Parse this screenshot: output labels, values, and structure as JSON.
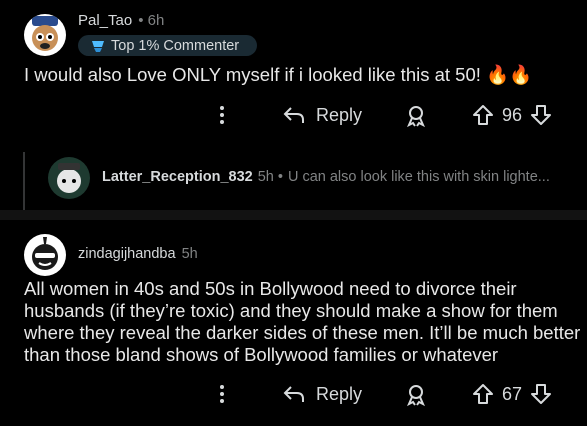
{
  "comments": [
    {
      "username": "Pal_Tao",
      "time": "• 6h",
      "badge": "Top 1% Commenter",
      "body": "I would also Love ONLY myself if i looked like this at 50! 🔥🔥",
      "reply_label": "Reply",
      "votes": "96",
      "reply": {
        "username": "Latter_Reception_832",
        "time": "5h •",
        "preview": "U can also look like this with skin lighte..."
      }
    },
    {
      "username": "zindagijhandba",
      "time": "5h",
      "body_lines": [
        "All women in 40s and 50s in Bollywood need to divorce their",
        "husbands (if they’re toxic) and they should make a show for them",
        "where they reveal the darker sides of these men. It’ll be much better",
        "than those bland shows of Bollywood families or whatever"
      ],
      "reply_label": "Reply",
      "votes": "67"
    }
  ],
  "colors": {
    "background": "#000000",
    "separator": "#121212",
    "text": "#d7dadc",
    "muted": "#818384",
    "badge_bg": "#1a2a33"
  }
}
